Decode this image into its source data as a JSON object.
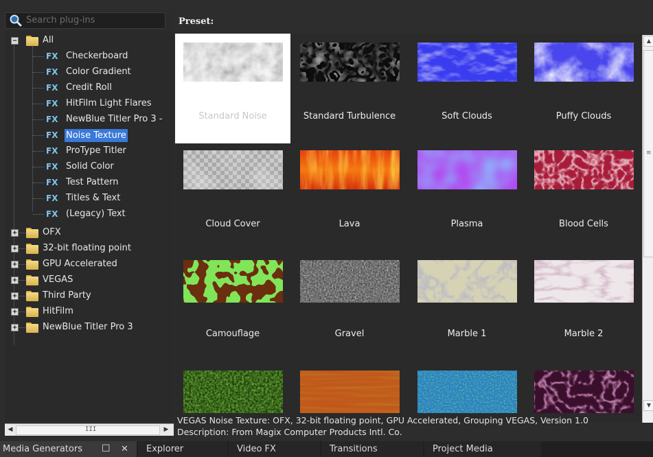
{
  "search": {
    "placeholder": "Search plug-ins"
  },
  "icons": {
    "search": "magnifier-icon",
    "fx": "fx-icon",
    "folder": "folder-icon",
    "restore": "restore-window-icon",
    "close": "close-icon"
  },
  "tree": {
    "root": {
      "label": "All",
      "expander": "−"
    },
    "fx_badge": "FX",
    "children": [
      "Checkerboard",
      "Color Gradient",
      "Credit Roll",
      "HitFilm Light Flares",
      "NewBlue Titler Pro 3 -",
      "Noise Texture",
      "ProType Titler",
      "Solid Color",
      "Test Pattern",
      "Titles & Text",
      "(Legacy) Text"
    ],
    "selected_child": "Noise Texture",
    "folders": [
      "OFX",
      "32-bit floating point",
      "GPU Accelerated",
      "VEGAS",
      "Third Party",
      "HitFilm",
      "NewBlue Titler Pro 3"
    ],
    "folder_expander": "+"
  },
  "hscroll": {
    "left": "◀",
    "right": "▶",
    "grip": "III"
  },
  "preset": {
    "label": "Preset:"
  },
  "presets": [
    {
      "name": "Standard Noise",
      "selected": true
    },
    {
      "name": "Standard Turbulence"
    },
    {
      "name": "Soft Clouds"
    },
    {
      "name": "Puffy Clouds"
    },
    {
      "name": "Cloud Cover"
    },
    {
      "name": "Lava"
    },
    {
      "name": "Plasma"
    },
    {
      "name": "Blood Cells"
    },
    {
      "name": "Camouflage"
    },
    {
      "name": "Gravel"
    },
    {
      "name": "Marble 1"
    },
    {
      "name": "Marble 2"
    },
    {
      "name": ""
    },
    {
      "name": ""
    },
    {
      "name": ""
    },
    {
      "name": ""
    }
  ],
  "vscroll": {
    "up": "▲",
    "down": "▼",
    "grip": "≡"
  },
  "description": {
    "line1": "VEGAS Noise Texture: OFX, 32-bit floating point, GPU Accelerated, Grouping VEGAS, Version 1.0",
    "line2": "Description: From Magix Computer Products Intl. Co."
  },
  "tabs": {
    "media_generators": "Media Generators",
    "restore_glyph": "☐",
    "close_glyph": "✕",
    "explorer": "Explorer",
    "video_fx": "Video FX",
    "transitions": "Transitions",
    "project_media": "Project Media"
  }
}
